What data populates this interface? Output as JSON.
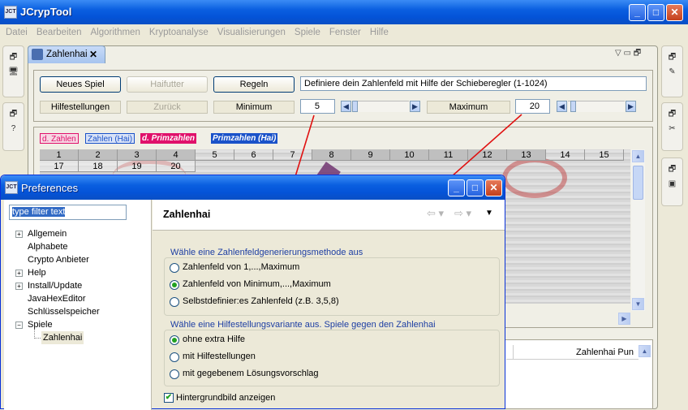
{
  "app": {
    "title": "JCrypTool",
    "icon_text": "JCT"
  },
  "menu": [
    "Datei",
    "Bearbeiten",
    "Algorithmen",
    "Kryptoanalyse",
    "Visualisierungen",
    "Spiele",
    "Fenster",
    "Hilfe"
  ],
  "tab": {
    "label": "Zahlenhai",
    "close": "✕"
  },
  "controls": {
    "new_game": "Neues Spiel",
    "haifutter": "Haifutter",
    "rules": "Regeln",
    "description": "Definiere dein Zahlenfeld mit Hilfe der Schieberegler (1-1024)",
    "hints": "Hilfestellungen",
    "back": "Zurück",
    "min_label": "Minimum",
    "min_value": "5",
    "max_label": "Maximum",
    "max_value": "20",
    "min_slider_fraction": 0.0,
    "max_slider_fraction": 0.02
  },
  "legend": [
    {
      "text": "d. Zahlen",
      "color": "#e0116b"
    },
    {
      "text": "Zahlen (Hai)",
      "color": "#1a52c9"
    },
    {
      "text": "d. Primzahlen",
      "color": "#e0116b"
    },
    {
      "text": "Primzahlen (Hai)",
      "color": "#1a52c9"
    }
  ],
  "numbers_row1": [
    "1",
    "2",
    "3",
    "4",
    "5",
    "6",
    "7",
    "8",
    "9",
    "10",
    "11",
    "12",
    "13",
    "14",
    "15"
  ],
  "numbers_row2": [
    "17",
    "18",
    "19",
    "20"
  ],
  "table_header": "Zahlenhai Pun",
  "dialog": {
    "title": "Preferences",
    "filter": "type filter text",
    "tree": [
      {
        "label": "Allgemein",
        "expander": "+"
      },
      {
        "label": "Alphabete",
        "expander": ""
      },
      {
        "label": "Crypto Anbieter",
        "expander": ""
      },
      {
        "label": "Help",
        "expander": "+"
      },
      {
        "label": "Install/Update",
        "expander": "+"
      },
      {
        "label": "JavaHexEditor",
        "expander": ""
      },
      {
        "label": "Schlüsselspeicher",
        "expander": ""
      },
      {
        "label": "Spiele",
        "expander": "−"
      }
    ],
    "tree_child": "Zahlenhai",
    "page_title": "Zahlenhai",
    "group1_label": "Wähle eine Zahlenfeldgenerierungsmethode aus",
    "group1_options": [
      "Zahlenfeld von 1,...,Maximum",
      "Zahlenfeld von Minimum,...,Maximum",
      "Selbstdefinier:es Zahlenfeld (z.B. 3,5,8)"
    ],
    "group1_selected": 1,
    "group2_label": "Wähle eine Hilfestellungsvariante aus. Spiele gegen den Zahlenhai",
    "group2_options": [
      "ohne extra Hilfe",
      "mit Hilfestellungen",
      "mit gegebenem Lösungsvorschlag"
    ],
    "group2_selected": 0,
    "checkbox_label": "Hintergrundbild anzeigen",
    "checkbox_checked": true
  },
  "colors": {
    "arrow": "#e01010",
    "titlebar": "#0a5fe0"
  }
}
